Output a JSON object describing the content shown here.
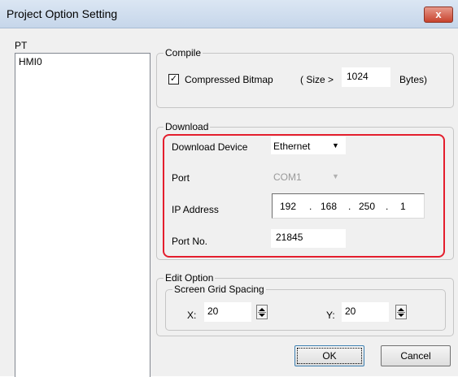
{
  "window": {
    "title": "Project Option Setting",
    "close_glyph": "x"
  },
  "pt": {
    "label": "PT",
    "items": [
      "HMI0"
    ]
  },
  "compile": {
    "group_label": "Compile",
    "compressed_checked": true,
    "check_glyph": "✓",
    "compressed_label": "Compressed Bitmap",
    "size_prefix": "( Size >",
    "size_value": "1024",
    "size_suffix": "Bytes)"
  },
  "download": {
    "group_label": "Download",
    "device_label": "Download Device",
    "device_value": "Ethernet",
    "port_label": "Port",
    "port_value": "COM1",
    "ip_label": "IP Address",
    "ip": [
      "192",
      "168",
      "250",
      "1"
    ],
    "ip_sep": ".",
    "portno_label": "Port No.",
    "portno_value": "21845",
    "highlight_color": "#e41e2d"
  },
  "edit_option": {
    "group_label": "Edit Option",
    "grid_label": "Screen Grid Spacing",
    "x_label": "X:",
    "x_value": "20",
    "y_label": "Y:",
    "y_value": "20"
  },
  "buttons": {
    "ok": "OK",
    "cancel": "Cancel"
  }
}
